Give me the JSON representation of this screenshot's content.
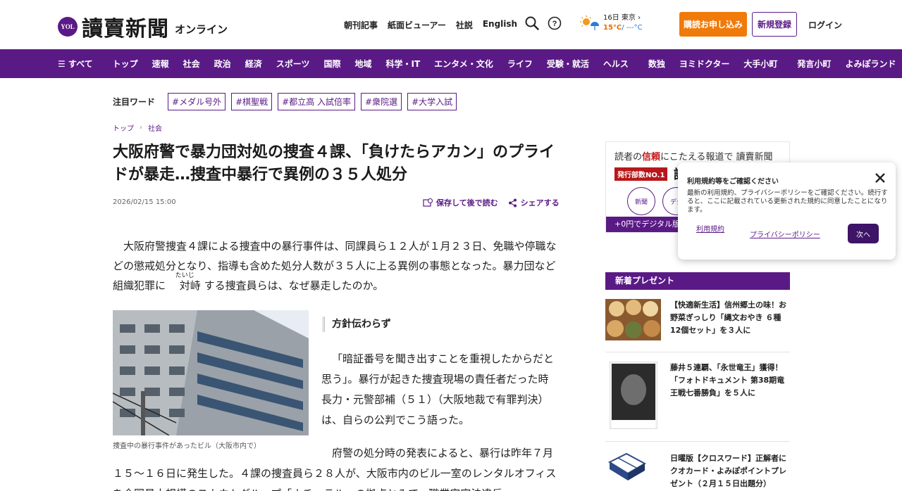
{
  "header": {
    "logo_badge": "YOL",
    "logo_text": "讀賣新聞",
    "logo_sub": "オンライン",
    "links": [
      "朝刊記事",
      "紙面ビューアー",
      "社説",
      "English"
    ],
    "weather": {
      "date_city": "16日 東京 ›",
      "temp_hi": "15°C",
      "temp_lo": "/ ---°C"
    },
    "subscribe_label": "購読お申し込み",
    "register_label": "新規登録",
    "login_label": "ログイン"
  },
  "nav": {
    "items": [
      "☰ すべて",
      "トップ",
      "速報",
      "社会",
      "政治",
      "経済",
      "スポーツ",
      "国際",
      "地域",
      "科学・IT",
      "エンタメ・文化",
      "ライフ",
      "受験・就活",
      "ヘルス",
      "数独",
      "ヨミドクター",
      "大手小町",
      "発言小町",
      "よみぽランド"
    ]
  },
  "trending": {
    "label": "注目ワード",
    "tags": [
      "#メダル号外",
      "#棋聖戦",
      "#都立高 入試倍率",
      "#衆院選",
      "#大学入試"
    ]
  },
  "breadcrumb": {
    "home": "トップ",
    "sep": "›",
    "section": "社会"
  },
  "article": {
    "title": "大阪府警で暴力団対処の捜査４課、「負けたらアカン」のプライドが暴走…捜査中暴行で異例の３５人処分",
    "date": "2026/02/15 15:00",
    "save_label": "保存して後で読む",
    "share_label": "シェアする",
    "lead_1": "大阪府警捜査４課による捜査中の暴行事件は、同課員ら１２人が１月２３日、免職や停職などの懲戒処分となり、指導も含めた処分人数が３５人に上る異例の事態となった。暴力団など組織犯罪に ",
    "lead_ruby": "対峙",
    "lead_ruby_reading": "たいじ",
    "lead_2": " する捜査員らは、なぜ暴走したのか。",
    "photo_caption": "捜査中の暴行事件があったビル（大阪市内で）",
    "subhead": "方針伝わらず",
    "para2": "「暗証番号を聞き出すことを重視したからだと思う」。暴行が起きた捜査現場の責任者だった時長力・元警部補（５１）（大阪地裁で有罪判決）は、自らの公判でこう語った。",
    "para3": "府警の処分時の発表によると、暴行は昨年７月１５～１６日に発生した。４課の捜査員ら２８人が、大阪市内のビル一室のレンタルオフィスを全国最大規模のスカウトグループ「ナチュラル」の拠点とみて、職業安定法違反"
  },
  "ad": {
    "headline_a": "読者の",
    "headline_b": "信頼",
    "headline_c": "にこたえる報道で",
    "brand": "讀賣新聞",
    "rank": "発行部数NO.1",
    "read_label": "読",
    "circle1": "新聞",
    "circle2": "デジ",
    "bottom": "+0円でデジタル版が"
  },
  "popup": {
    "title": "利用規約等をご確認ください",
    "body": "最新の利用規約、プライバシーポリシーをご確認ください。続行すると、ここに記載されている更新された規約に同意したことになります。",
    "terms_link": "利用規約",
    "privacy_link": "プライバシーポリシー",
    "next_label": "次へ"
  },
  "sidebar": {
    "heading": "新着プレゼント",
    "presents": [
      {
        "text": "【快適新生活】信州郷土の味！お野菜ぎっしり「縄文おやき ６種12個セット」を３人に",
        "thumb": "oyaki"
      },
      {
        "text": "藤井５連覇、「永世竜王」獲得！「フォトドキュメント 第38期竜王戦七番勝負」を５人に",
        "thumb": "book"
      },
      {
        "text": "日曜版【クロスワード】正解者にクオカード・よみぽポイントプレゼント（２月１５日出題分）",
        "thumb": "crossword"
      }
    ]
  },
  "colors": {
    "brand_purple": "#5a1a86",
    "subscribe_orange": "#f07a0a"
  }
}
